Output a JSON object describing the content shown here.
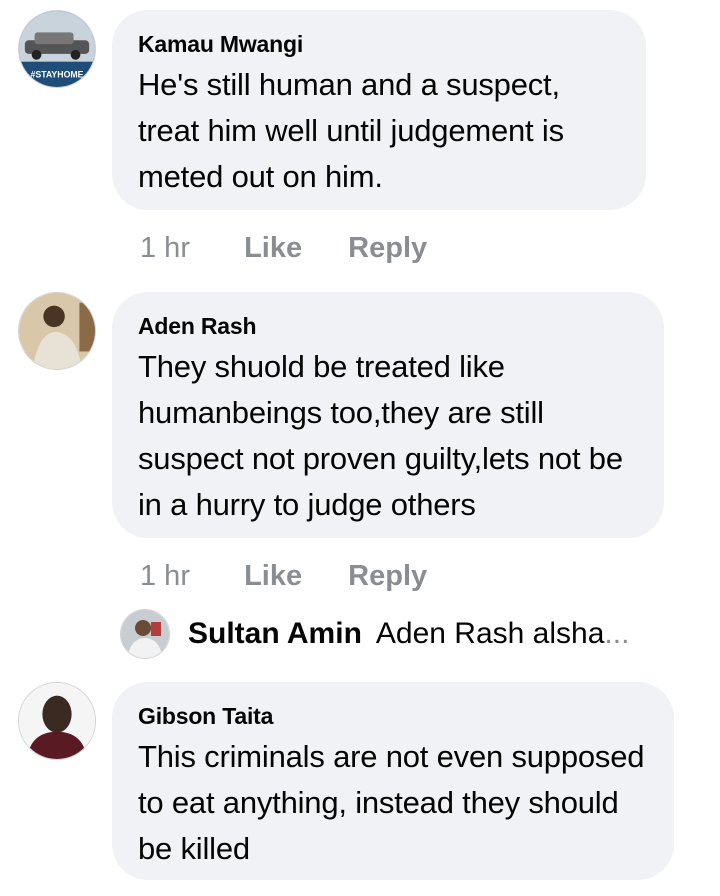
{
  "comments": [
    {
      "author": "Kamau Mwangi",
      "text": "He's still human and a suspect, treat him well until judgement is meted out on him.",
      "time": "1 hr",
      "like": "Like",
      "reply": "Reply",
      "avatar_badge": "#STAYHOME"
    },
    {
      "author": "Aden Rash",
      "text": "They shuold be treated like humanbeings too,they are still suspect not proven guilty,lets not be in a hurry to judge others",
      "time": "1 hr",
      "like": "Like",
      "reply": "Reply"
    },
    {
      "author": "Gibson Taita",
      "text": "This criminals are not even supposed to eat anything, instead they should  be killed"
    }
  ],
  "reply_preview": {
    "author": "Sultan Amin",
    "text": "Aden Rash alsha",
    "ellipsis": "..."
  },
  "colors": {
    "bubble": "#f0f2f5",
    "muted": "#8a8d91",
    "text": "#050505"
  }
}
